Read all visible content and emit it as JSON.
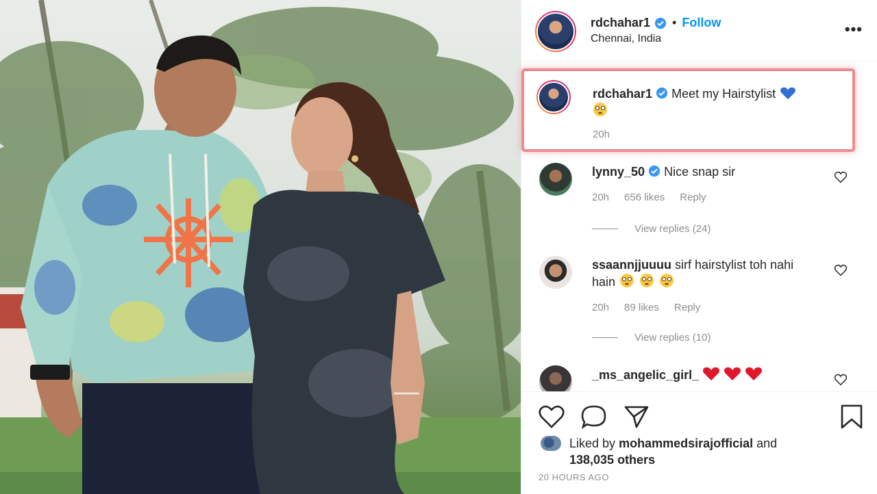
{
  "post": {
    "author": "rdchahar1",
    "follow_label": "Follow",
    "separator": "•",
    "location": "Chennai, India",
    "more_label": "•••",
    "caption": {
      "username": "rdchahar1",
      "text": "Meet my Hairstylist",
      "emojis": [
        "blue-heart",
        "flushed-face"
      ],
      "time": "20h"
    }
  },
  "comments": [
    {
      "username": "lynny_50",
      "verified": true,
      "text": "Nice snap sir",
      "time": "20h",
      "likes": "656 likes",
      "reply_label": "Reply",
      "view_replies": "View replies (24)"
    },
    {
      "username": "ssaannjjuuuu",
      "verified": false,
      "text": "sirf hairstylist toh nahi hain",
      "emojis": [
        "flushed-face",
        "flushed-face",
        "flushed-face"
      ],
      "time": "20h",
      "likes": "89 likes",
      "reply_label": "Reply",
      "view_replies": "View replies (10)"
    },
    {
      "username": "_ms_angelic_girl_",
      "verified": false,
      "emojis": [
        "red-heart",
        "red-heart",
        "red-heart"
      ]
    }
  ],
  "liked_by": {
    "prefix": "Liked by",
    "user": "mohammedsirajofficial",
    "connector": "and",
    "count": "138,035 others"
  },
  "timestamp": "20 HOURS AGO",
  "icons": {
    "like": "heart-outline-icon",
    "comment": "comment-bubble-icon",
    "share": "paper-plane-icon",
    "save": "bookmark-icon",
    "verified": "verified-badge-icon"
  },
  "colors": {
    "follow": "#0095f6",
    "verified": "#3897f0",
    "highlight_border": "#ec8a8f",
    "muted_text": "#8e8e8e",
    "red_heart": "#e0162b",
    "blue_heart": "#2f6fd6"
  }
}
